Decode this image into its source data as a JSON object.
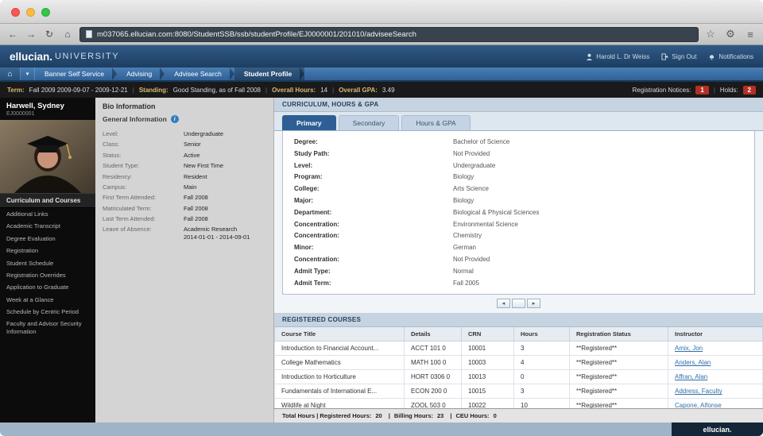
{
  "browser": {
    "url": "m037065.ellucian.com:8080/StudentSSB/ssb/studentProfile/EJ0000001/201010/adviseeSearch",
    "icons": {
      "back": "←",
      "forward": "→",
      "refresh": "↻",
      "home": "⌂",
      "star": "☆",
      "gear": "⚙",
      "menu": "≡"
    }
  },
  "header": {
    "brand": "ellucian.",
    "brand_suffix": "UNIVERSITY",
    "user_name": "Harold L. Dr Weiss",
    "sign_out_label": "Sign Out",
    "notifications_label": "Notifications"
  },
  "nav": {
    "home_icon": "⌂",
    "caret": "▾",
    "items": [
      "Banner Self Service",
      "Advising",
      "Advisee Search",
      "Student Profile"
    ]
  },
  "term_bar": {
    "sep": "|",
    "term_label": "Term:",
    "term_value": "Fall 2009 2009-09-07 - 2009-12-21",
    "standing_label": "Standing:",
    "standing_value": "Good Standing, as of Fall 2008",
    "overall_hours_label": "Overall Hours:",
    "overall_hours_value": "14",
    "overall_gpa_label": "Overall GPA:",
    "overall_gpa_value": "3.49",
    "notices_label": "Registration Notices:",
    "notices_count": "1",
    "holds_label": "Holds:",
    "holds_count": "2"
  },
  "sidebar": {
    "student_name": "Harwell, Sydney",
    "student_id": "EJ0000001",
    "section_title": "Curriculum and Courses",
    "links": [
      "Additional Links",
      "Academic Transcript",
      "Degree Evaluation",
      "Registration",
      "Student Schedule",
      "Registration Overrides",
      "Application to Graduate",
      "Week at a Glance",
      "Schedule by Centric Period",
      "Faculty and Advisor Security Information"
    ]
  },
  "bio": {
    "title": "Bio Information",
    "section_title": "General Information",
    "info_glyph": "i",
    "fields": [
      {
        "label": "Level:",
        "value": "Undergraduate"
      },
      {
        "label": "Class:",
        "value": "Senior"
      },
      {
        "label": "Status:",
        "value": "Active"
      },
      {
        "label": "Student Type:",
        "value": "New First Time"
      },
      {
        "label": "Residency:",
        "value": "Resident"
      },
      {
        "label": "Campus:",
        "value": "Main"
      },
      {
        "label": "First Term Attended:",
        "value": "Fall 2008"
      },
      {
        "label": "Matriculated Term:",
        "value": "Fall 2008"
      },
      {
        "label": "Last Term Attended:",
        "value": "Fall 2008"
      },
      {
        "label": "Leave of Absence:",
        "value": "Academic Research",
        "value2": "2014-01-01 - 2014-09-01"
      }
    ]
  },
  "curriculum": {
    "title": "CURRICULUM, HOURS & GPA",
    "tabs": [
      "Primary",
      "Secondary",
      "Hours & GPA"
    ],
    "active_tab": "Primary",
    "pager_prev": "◂",
    "pager_next": "▸",
    "fields": [
      {
        "label": "Degree:",
        "value": "Bachelor of Science"
      },
      {
        "label": "Study Path:",
        "value": "Not Provided"
      },
      {
        "label": "Level:",
        "value": "Undergraduate"
      },
      {
        "label": "Program:",
        "value": "Biology"
      },
      {
        "label": "College:",
        "value": "Arts Science"
      },
      {
        "label": "Major:",
        "value": "Biology"
      },
      {
        "label": "Department:",
        "value": "Biological & Physical Sciences"
      },
      {
        "label": "Concentration:",
        "value": "Environmental Science"
      },
      {
        "label": "Concentration:",
        "value": "Chemistry"
      },
      {
        "label": "Minor:",
        "value": "German"
      },
      {
        "label": "Concentration:",
        "value": "Not Provided"
      },
      {
        "label": "Admit Type:",
        "value": "Normal"
      },
      {
        "label": "Admit Term:",
        "value": "Fall 2005"
      }
    ]
  },
  "courses": {
    "title": "REGISTERED COURSES",
    "columns": [
      "Course Title",
      "Details",
      "CRN",
      "Hours",
      "Registration Status",
      "Instructor"
    ],
    "rows": [
      {
        "title": "Introduction to Financial Account...",
        "details": "ACCT 101 0",
        "crn": "10001",
        "hours": "3",
        "status": "**Registered**",
        "instructor": "Amix, Jon"
      },
      {
        "title": "College Mathematics",
        "details": "MATH 100 0",
        "crn": "10003",
        "hours": "4",
        "status": "**Registered**",
        "instructor": "Anders, Alan"
      },
      {
        "title": "Introduction to Horticulture",
        "details": "HORT 0306 0",
        "crn": "10013",
        "hours": "0",
        "status": "**Registered**",
        "instructor": "Affran, Alan"
      },
      {
        "title": "Fundamentals of International E...",
        "details": "ECON 200 0",
        "crn": "10015",
        "hours": "3",
        "status": "**Registered**",
        "instructor": "Address, Faculty"
      },
      {
        "title": "Wildlife at Night",
        "details": "ZOOL 503 0",
        "crn": "10022",
        "hours": "10",
        "status": "**Registered**",
        "instructor": "Capone, Alfonse"
      }
    ]
  },
  "totals": {
    "label_1": "Total Hours | Registered Hours:",
    "value_1": "20",
    "sep": "|",
    "label_2": "Billing Hours:",
    "value_2": "23",
    "label_3": "CEU Hours:",
    "value_3": "0"
  },
  "footer": {
    "brand": "ellucian."
  }
}
